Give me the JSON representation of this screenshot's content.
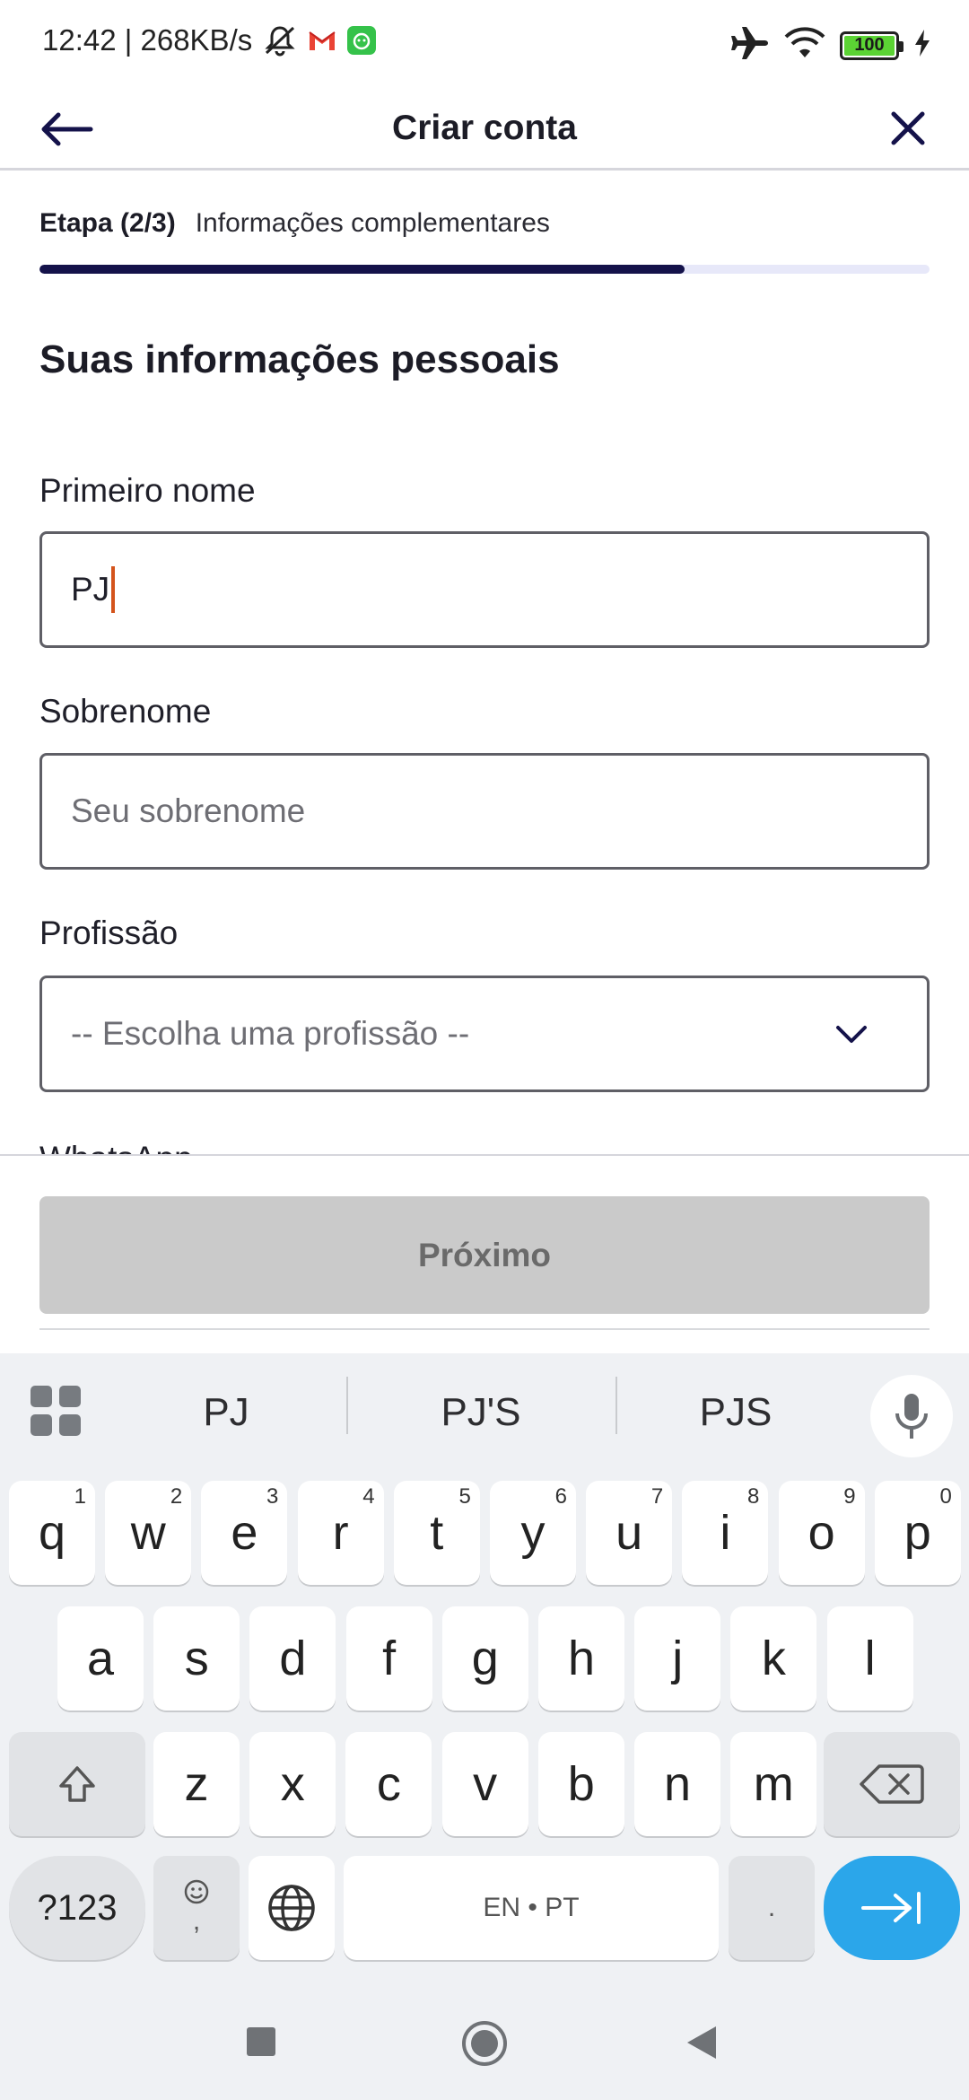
{
  "status_bar": {
    "time_speed": "12:42 | 268KB/s",
    "battery_level": "100",
    "icons": [
      "mute-icon",
      "gmail-icon",
      "app-icon",
      "airplane-icon",
      "wifi-icon",
      "battery-icon",
      "charging-icon"
    ]
  },
  "header": {
    "title": "Criar conta",
    "back_icon": "arrow-left-icon",
    "close_icon": "close-icon"
  },
  "step": {
    "label": "Etapa (2/3)",
    "description": "Informações complementares",
    "progress": 0.725
  },
  "form": {
    "section_title": "Suas informações pessoais",
    "first_name": {
      "label": "Primeiro nome",
      "value": "PJ"
    },
    "last_name": {
      "label": "Sobrenome",
      "placeholder": "Seu sobrenome"
    },
    "profession": {
      "label": "Profissão",
      "selected": "-- Escolha uma profissão --"
    },
    "next_field_label": "WhatsApp"
  },
  "footer": {
    "next_label": "Próximo"
  },
  "keyboard": {
    "suggestions": [
      "PJ",
      "PJ'S",
      "PJS"
    ],
    "row1": [
      {
        "k": "q",
        "h": "1"
      },
      {
        "k": "w",
        "h": "2"
      },
      {
        "k": "e",
        "h": "3"
      },
      {
        "k": "r",
        "h": "4"
      },
      {
        "k": "t",
        "h": "5"
      },
      {
        "k": "y",
        "h": "6"
      },
      {
        "k": "u",
        "h": "7"
      },
      {
        "k": "i",
        "h": "8"
      },
      {
        "k": "o",
        "h": "9"
      },
      {
        "k": "p",
        "h": "0"
      }
    ],
    "row2": [
      "a",
      "s",
      "d",
      "f",
      "g",
      "h",
      "j",
      "k",
      "l"
    ],
    "row3": [
      "z",
      "x",
      "c",
      "v",
      "b",
      "n",
      "m"
    ],
    "symbols_label": "?123",
    "comma_label": ",",
    "space_label": "EN • PT",
    "period_label": ".",
    "colors": {
      "enter": "#2ba6ea",
      "progress": "#14124a",
      "caret": "#d4541c"
    }
  }
}
